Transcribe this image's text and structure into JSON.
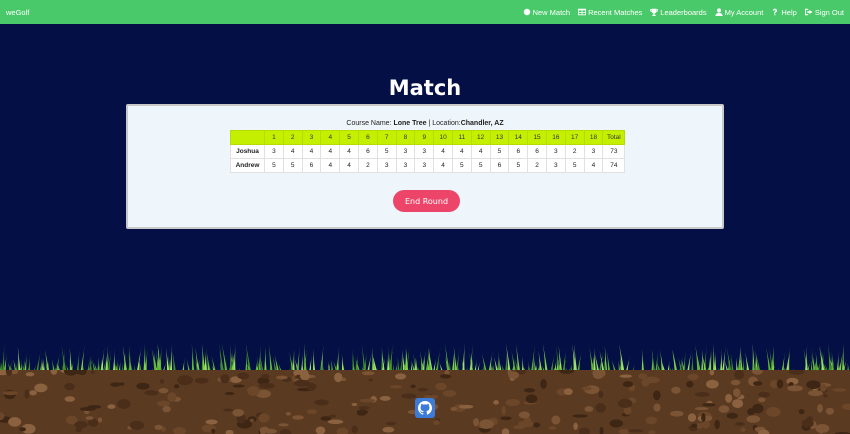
{
  "navbar": {
    "brand": "weGolf",
    "items": [
      {
        "label": "New Match",
        "icon": "dot-icon"
      },
      {
        "label": "Recent Matches",
        "icon": "table-icon"
      },
      {
        "label": "Leaderboards",
        "icon": "trophy-icon"
      },
      {
        "label": "My Account",
        "icon": "user-icon"
      },
      {
        "label": "Help",
        "icon": "question-icon"
      },
      {
        "label": "Sign Out",
        "icon": "sign-out-icon"
      }
    ]
  },
  "page": {
    "title": "Match"
  },
  "course": {
    "name_label": "Course Name: ",
    "name": "Lone Tree",
    "separator": " | ",
    "location_label": "Location:",
    "location": "Chandler, AZ"
  },
  "scorecard": {
    "holes": [
      "1",
      "2",
      "3",
      "4",
      "5",
      "6",
      "7",
      "8",
      "9",
      "10",
      "11",
      "12",
      "13",
      "14",
      "15",
      "16",
      "17",
      "18"
    ],
    "total_label": "Total",
    "players": [
      {
        "name": "Joshua",
        "scores": [
          "3",
          "4",
          "4",
          "4",
          "4",
          "6",
          "5",
          "3",
          "3",
          "4",
          "4",
          "4",
          "5",
          "6",
          "6",
          "3",
          "2",
          "3"
        ],
        "total": "73"
      },
      {
        "name": "Andrew",
        "scores": [
          "5",
          "5",
          "6",
          "4",
          "4",
          "2",
          "3",
          "3",
          "3",
          "4",
          "5",
          "5",
          "6",
          "5",
          "2",
          "3",
          "5",
          "4"
        ],
        "total": "74"
      }
    ]
  },
  "actions": {
    "end_round": "End Round"
  },
  "footer": {
    "icon": "github-icon"
  },
  "colors": {
    "navbar": "#4ac96b",
    "background": "#040f45",
    "table_header": "#c4f000",
    "end_button": "#ed4569",
    "soil": "#5b3a22",
    "grass": "#6fc13a"
  }
}
